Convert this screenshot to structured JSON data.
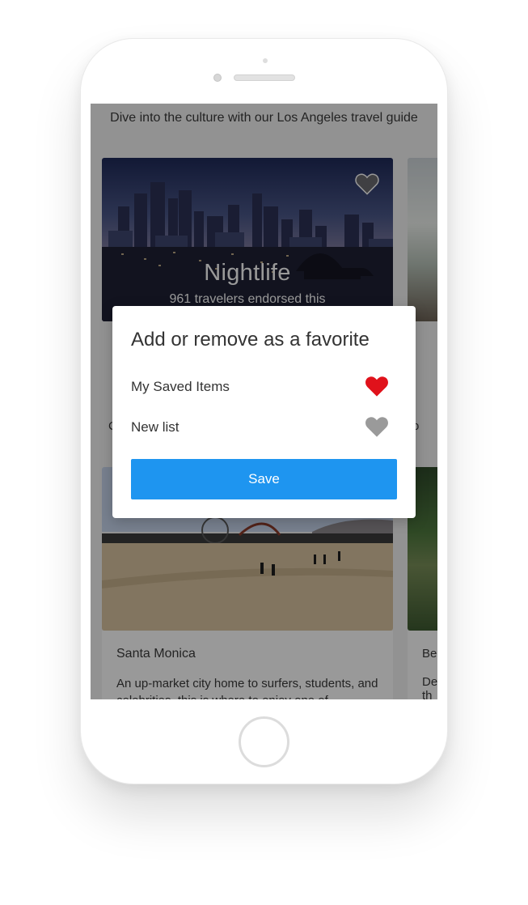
{
  "guide": {
    "intro": "Dive into the culture with our Los Angeles travel guide"
  },
  "cards": {
    "nightlife": {
      "title": "Nightlife",
      "subtitle": "961 travelers endorsed this",
      "icon": "heart-icon"
    },
    "santa_monica": {
      "name": "Santa Monica",
      "description": "An up-market city home to surfers, students, and celebrities, this is where to enjoy one of"
    },
    "peek": {
      "name": "Be",
      "description": "De",
      "description_2": "th"
    },
    "peek_under_left": "C",
    "peek_under_right": "o"
  },
  "favorite_dialog": {
    "title": "Add or remove as a favorite",
    "lists": [
      {
        "label": "My Saved Items",
        "favorited": true,
        "icon": "heart-icon",
        "color": "#e0121b"
      },
      {
        "label": "New list",
        "favorited": false,
        "icon": "heart-icon",
        "color": "#9a9a9a"
      }
    ],
    "save_label": "Save",
    "accent_color": "#1e95f0"
  }
}
